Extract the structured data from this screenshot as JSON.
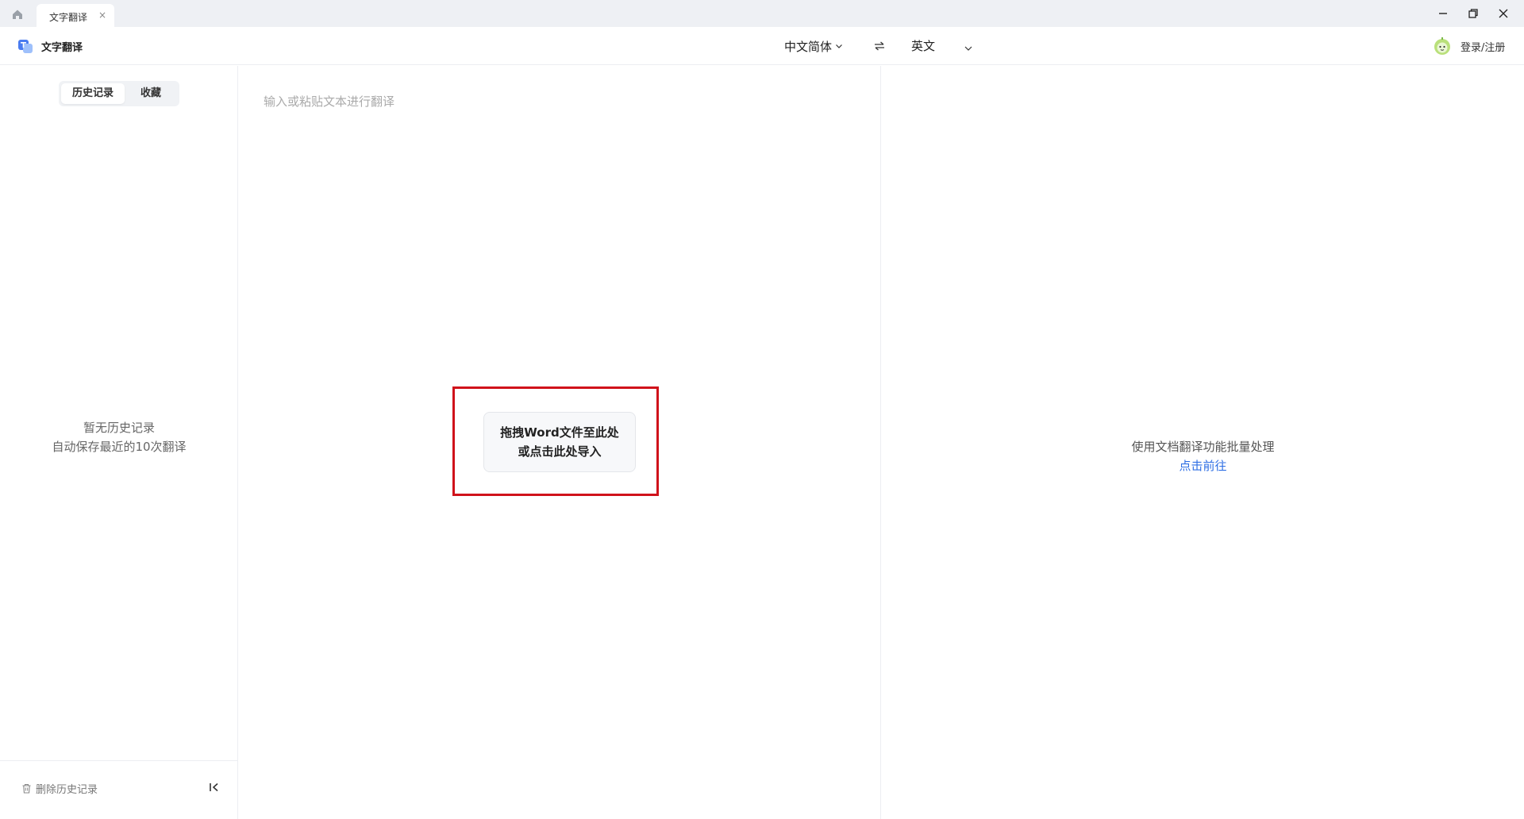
{
  "tabbar": {
    "tab_label": "文字翻译",
    "tab_close": "×"
  },
  "toolbar": {
    "app_name": "文字翻译",
    "source_language": "中文简体",
    "target_language": "英文",
    "login_label": "登录/注册"
  },
  "sidebar": {
    "tabs": [
      {
        "label": "历史记录",
        "active": true
      },
      {
        "label": "收藏",
        "active": false
      }
    ],
    "empty_title": "暂无历史记录",
    "empty_subtitle": "自动保存最近的10次翻译",
    "delete_label": "删除历史记录"
  },
  "input": {
    "placeholder": "输入或粘贴文本进行翻译",
    "drop_line1": "拖拽Word文件至此处",
    "drop_line2": "或点击此处导入"
  },
  "output": {
    "doc_hint": "使用文档翻译功能批量处理",
    "doc_link": "点击前往"
  },
  "colors": {
    "accent_link": "#2f6fe4",
    "highlight_border": "#d0121b",
    "tabbar_bg": "#eef0f4"
  },
  "icons": [
    "home-icon",
    "close-icon",
    "minimize-icon",
    "restore-icon",
    "app-logo-icon",
    "chevron-down-icon",
    "swap-icon",
    "avatar-icon",
    "trash-icon",
    "collapse-left-icon"
  ]
}
